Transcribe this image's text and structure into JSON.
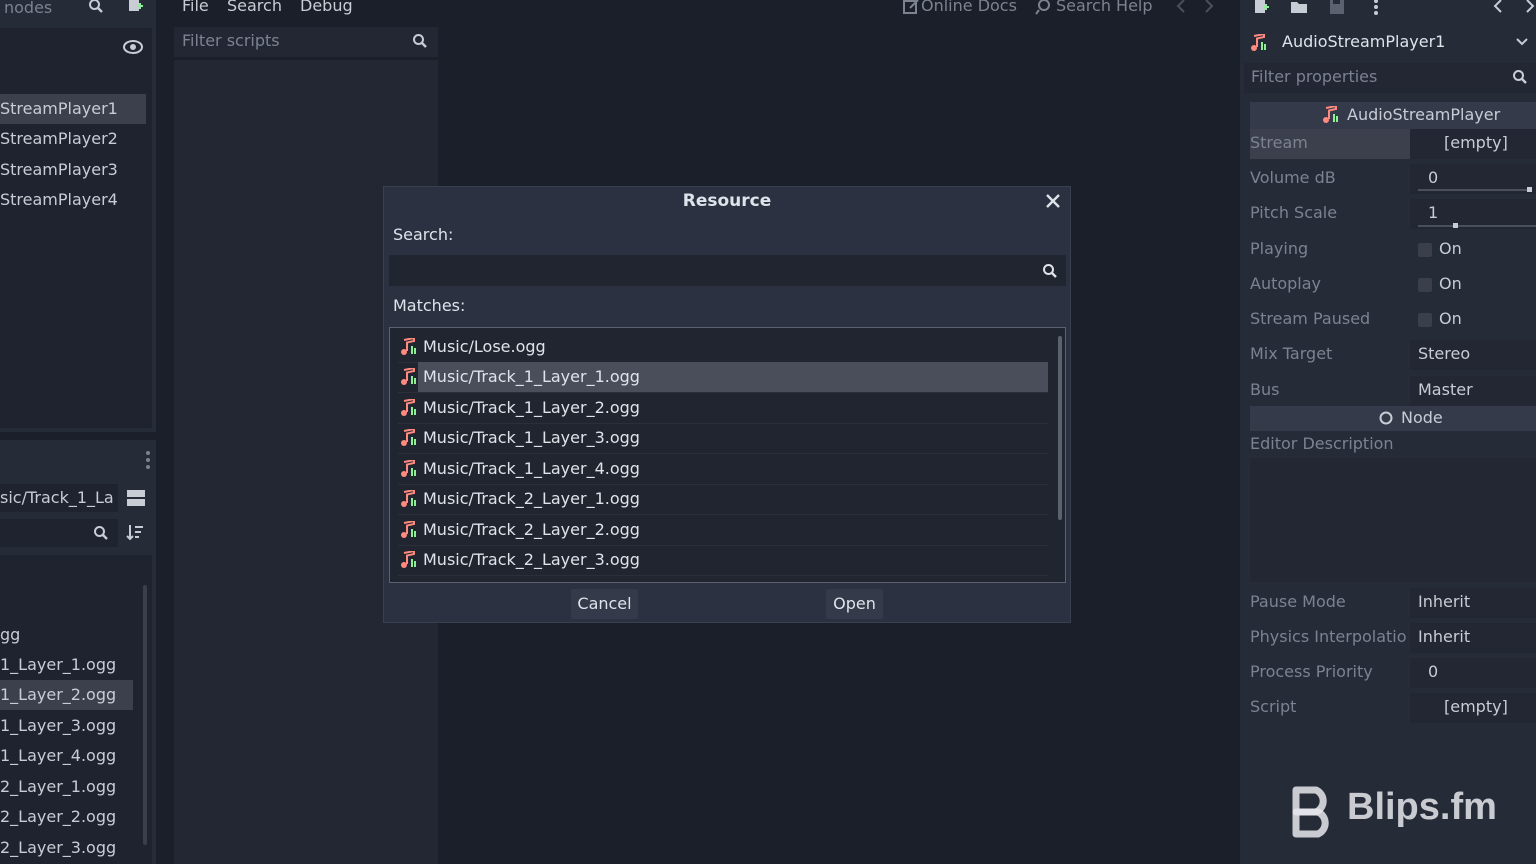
{
  "scene_dock": {
    "filter_placeholder": "nodes",
    "items": [
      "StreamPlayer1",
      "StreamPlayer2",
      "StreamPlayer3",
      "StreamPlayer4"
    ],
    "selected_index": 0
  },
  "filesystem_dock": {
    "path_value": "sic/Track_1_La",
    "files": [
      "gg",
      "1_Layer_1.ogg",
      "1_Layer_2.ogg",
      "1_Layer_3.ogg",
      "1_Layer_4.ogg",
      "2_Layer_1.ogg",
      "2_Layer_2.ogg",
      "2_Layer_3.ogg"
    ],
    "selected_index": 2
  },
  "script_editor": {
    "menu": [
      "File",
      "Search",
      "Debug"
    ],
    "online_docs": "Online Docs",
    "search_help": "Search Help",
    "filter_placeholder": "Filter scripts"
  },
  "inspector": {
    "node_name": "AudioStreamPlayer1",
    "filter_placeholder": "Filter properties",
    "class_header": "AudioStreamPlayer",
    "node_header": "Node",
    "properties": [
      {
        "label": "Stream",
        "value": "[empty]"
      },
      {
        "label": "Volume dB",
        "value": "0"
      },
      {
        "label": "Pitch Scale",
        "value": "1"
      },
      {
        "label": "Playing",
        "value": "On"
      },
      {
        "label": "Autoplay",
        "value": "On"
      },
      {
        "label": "Stream Paused",
        "value": "On"
      },
      {
        "label": "Mix Target",
        "value": "Stereo"
      },
      {
        "label": "Bus",
        "value": "Master"
      }
    ],
    "editor_description_label": "Editor Description",
    "lower_properties": [
      {
        "label": "Pause Mode",
        "value": "Inherit"
      },
      {
        "label": "Physics Interpolatio",
        "value": "Inherit"
      },
      {
        "label": "Process Priority",
        "value": "0"
      },
      {
        "label": "Script",
        "value": "[empty]"
      }
    ]
  },
  "dialog": {
    "title": "Resource",
    "search_label": "Search:",
    "search_value": "",
    "matches_label": "Matches:",
    "matches": [
      "Music/Lose.ogg",
      "Music/Track_1_Layer_1.ogg",
      "Music/Track_1_Layer_2.ogg",
      "Music/Track_1_Layer_3.ogg",
      "Music/Track_1_Layer_4.ogg",
      "Music/Track_2_Layer_1.ogg",
      "Music/Track_2_Layer_2.ogg",
      "Music/Track_2_Layer_3.ogg"
    ],
    "selected_index": 1,
    "cancel_label": "Cancel",
    "open_label": "Open"
  },
  "watermark": {
    "text": "Blips.fm"
  },
  "colors": {
    "background": "#1b1f29",
    "panel": "#262b38",
    "dialog": "#2c3141",
    "selection": "#4a4e5b",
    "accent_audio_icon_green": "#8eef97",
    "accent_audio_icon_red": "#ff8a80"
  }
}
